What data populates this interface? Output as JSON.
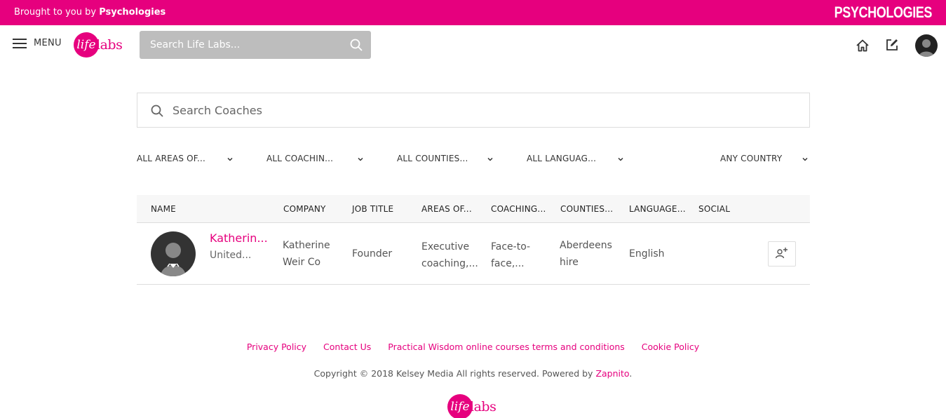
{
  "topbar": {
    "brought_prefix": "Brought to you by",
    "brought_brand": "Psychologies",
    "brand_logo": "PSYCHOLOGIES"
  },
  "header": {
    "menu_label": "MENU",
    "logo_life": "life",
    "logo_labs": "labs",
    "search_placeholder": "Search Life Labs...",
    "icons": [
      "menu-icon",
      "search-icon",
      "home-icon",
      "edit-icon",
      "avatar"
    ]
  },
  "coach_search": {
    "placeholder": "Search Coaches"
  },
  "filters": [
    "ALL AREAS OF...",
    "ALL COACHIN...",
    "ALL COUNTIES...",
    "ALL LANGUAG...",
    "ANY COUNTRY"
  ],
  "table": {
    "headers": [
      "NAME",
      "COMPANY",
      "JOB TITLE",
      "AREAS OF...",
      "COACHING...",
      "COUNTIES...",
      "LANGUAGE...",
      "SOCIAL"
    ],
    "rows": [
      {
        "name": "Katherin...",
        "country": "United...",
        "company_line1": "Katherine",
        "company_line2": "Weir Co",
        "job_title": "Founder",
        "areas_line1": "Executive",
        "areas_line2": "coaching,...",
        "coaching_line1": "Face-to-",
        "coaching_line2": "face,...",
        "counties_line1": "Aberdeens",
        "counties_line2": "hire",
        "language": "English"
      }
    ]
  },
  "footer": {
    "links": [
      "Privacy Policy",
      "Contact Us",
      "Practical Wisdom online courses terms and conditions",
      "Cookie Policy"
    ],
    "copyright_prefix": "Copyright © 2018 Kelsey Media All rights reserved. Powered by",
    "powered_by": "Zapnito",
    "copyright_suffix": ".",
    "logo_life": "life",
    "logo_labs": "labs"
  },
  "colors": {
    "brand": "#e6007e",
    "search_bg": "#bdbdbd",
    "table_head_bg": "#f7f7f7"
  }
}
